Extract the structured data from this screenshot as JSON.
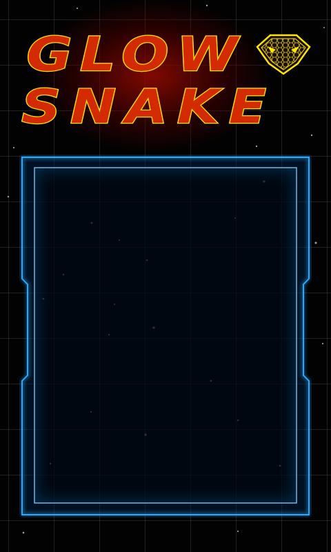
{
  "game": {
    "title_line1": "GLOW",
    "title_line2": "SNAKE"
  },
  "icons": {
    "emblem": "snake-head-icon"
  },
  "colors": {
    "title_fill": "#d42a00",
    "title_outline": "#ffe600",
    "frame_glow": "#2aa8ff",
    "grid_line": "#6e6e78",
    "background": "#020202"
  }
}
